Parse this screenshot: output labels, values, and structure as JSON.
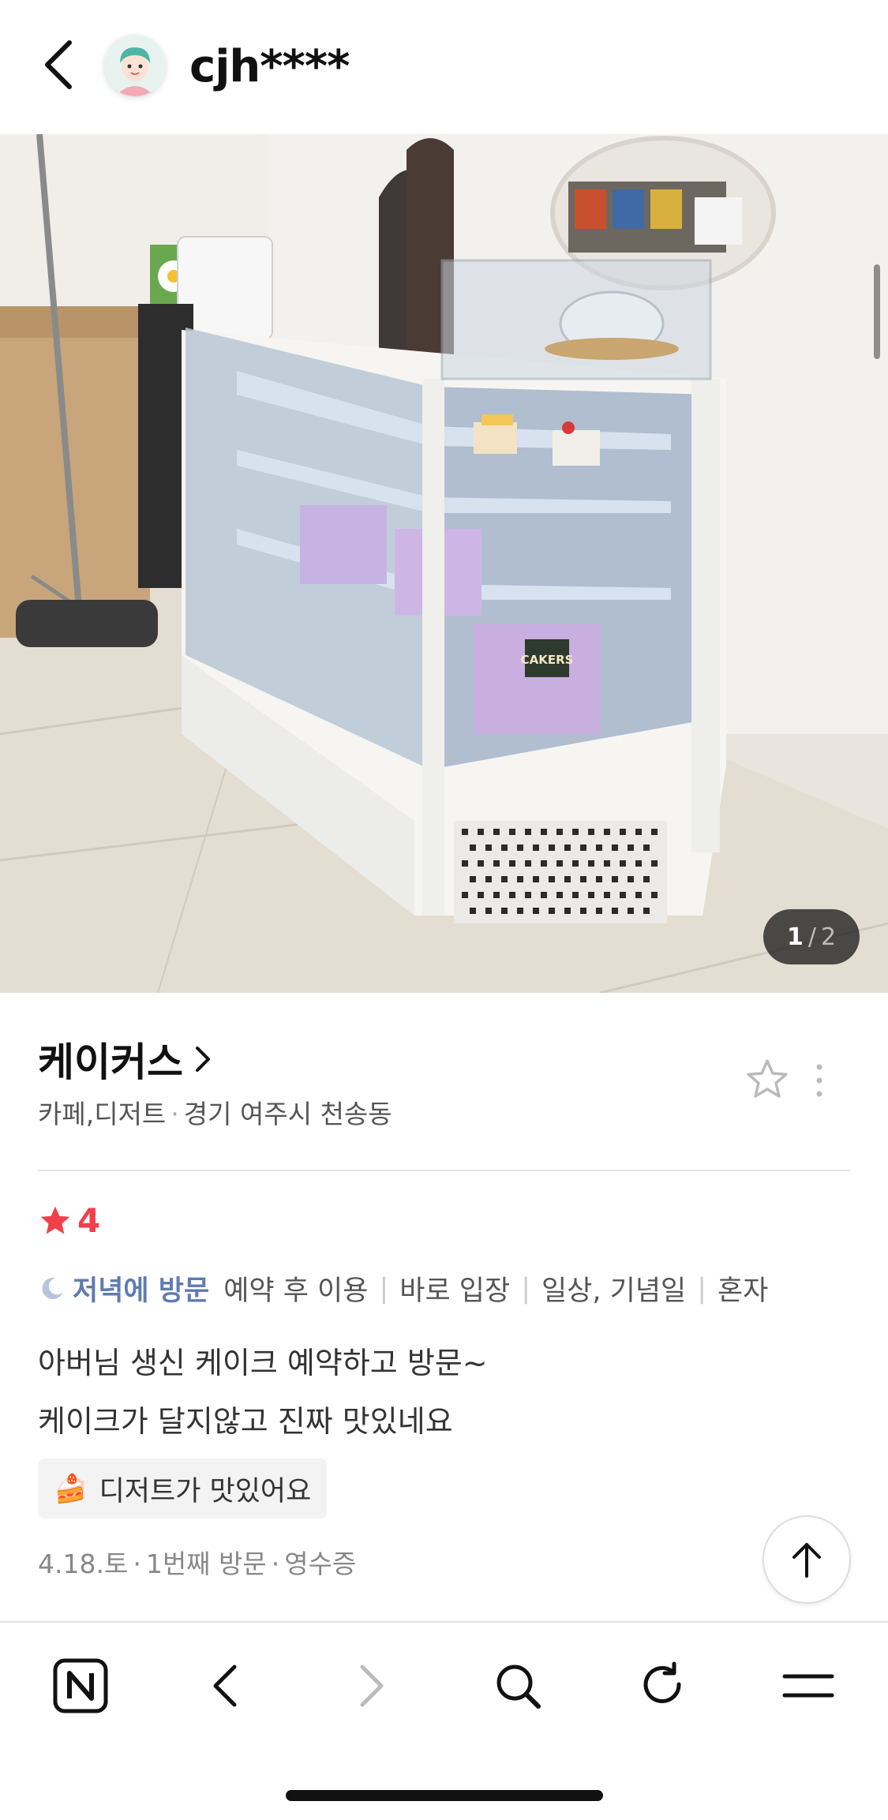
{
  "header": {
    "username": "cjh****",
    "back_icon": "chevron-left-icon",
    "avatar": "user-avatar"
  },
  "photo": {
    "pager_current": "1",
    "pager_separator": "/",
    "pager_total": "2",
    "sign_text": "CAKERS"
  },
  "place": {
    "name": "케이커스",
    "category": "카페,디저트",
    "separator": "·",
    "location": "경기 여주시 천송동"
  },
  "review": {
    "rating": "4",
    "visit_time": "저녁에 방문",
    "tags": [
      "예약 후 이용",
      "바로 입장",
      "일상, 기념일",
      "혼자"
    ],
    "text_lines": [
      "아버님 생신 케이크 예약하고 방문~",
      "케이크가 달지않고 진짜 맛있네요"
    ],
    "keyword": {
      "emoji": "🍰",
      "label": "디저트가 맛있어요"
    },
    "meta": {
      "date": "4.18.토",
      "visit_count": "1번째 방문",
      "verification": "영수증",
      "separator": "·"
    }
  },
  "colors": {
    "rating_red": "#f0404a",
    "visit_time_blue": "#5f7bb2",
    "divider": "#e6e6e6"
  },
  "bottom_nav": {
    "items": [
      "naver-home-icon",
      "back-arrow-icon",
      "forward-arrow-icon",
      "search-icon",
      "refresh-icon",
      "menu-icon"
    ]
  }
}
